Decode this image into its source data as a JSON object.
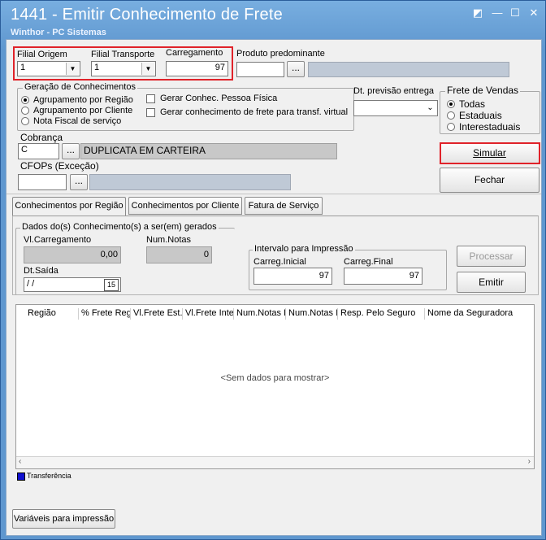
{
  "window": {
    "title": "1441 - Emitir Conhecimento de Frete",
    "subtitle": "Winthor - PC Sistemas",
    "controls": {
      "help": "◩",
      "minimize": "—",
      "maximize": "☐",
      "close": "✕"
    }
  },
  "filters": {
    "filial_origem": {
      "label": "Filial Origem",
      "value": "1"
    },
    "filial_transporte": {
      "label": "Filial Transporte",
      "value": "1"
    },
    "carregamento": {
      "label": "Carregamento",
      "value": "97"
    },
    "produto": {
      "label": "Produto predominante",
      "value": "",
      "button": "...",
      "description": ""
    }
  },
  "geracao": {
    "title": "Geração de Conhecimentos",
    "options": [
      "Agrupamento por Região",
      "Agrupamento por Cliente",
      "Nota Fiscal de serviço"
    ],
    "selected_index": 0,
    "checks": [
      "Gerar Conhec. Pessoa Física",
      "Gerar conhecimento de frete para transf. virtual"
    ]
  },
  "previsao": {
    "label": "Dt. previsão entrega",
    "value": ""
  },
  "frete_vendas": {
    "title": "Frete de Vendas",
    "options": [
      "Todas",
      "Estaduais",
      "Interestaduais"
    ],
    "selected_index": 0
  },
  "cobranca": {
    "label": "Cobrança",
    "code": "C",
    "button": "...",
    "description": "DUPLICATA EM CARTEIRA"
  },
  "cfops": {
    "label": "CFOPs  (Exceção)",
    "value": "",
    "button": "...",
    "description": ""
  },
  "actions": {
    "simular": "Simular",
    "fechar": "Fechar"
  },
  "tabs": [
    "Conhecimentos por Região",
    "Conhecimentos por Cliente",
    "Fatura de Serviço"
  ],
  "active_tab": 0,
  "dados": {
    "title": "Dados do(s) Conhecimento(s) a ser(em) gerados",
    "vl_carregamento_label": "Vl.Carregamento",
    "vl_carregamento": "0,00",
    "num_notas_label": "Num.Notas",
    "num_notas": "0",
    "dt_saida_label": "Dt.Saída",
    "dt_saida": " / /",
    "calendar": "15"
  },
  "intervalo": {
    "title": "Intervalo para Impressão",
    "inicial_label": "Carreg.Inicial",
    "inicial": "97",
    "final_label": "Carreg.Final",
    "final": "97"
  },
  "buttons2": {
    "processar": "Processar",
    "emitir": "Emitir"
  },
  "grid": {
    "columns": [
      "Região",
      "% Frete Reg",
      "Vl.Frete Est.",
      "Vl.Frete Inte",
      "Num.Notas E",
      "Num.Notas I",
      "Resp. Pelo Seguro",
      "Nome da Seguradora"
    ],
    "empty_text": "<Sem dados para mostrar>"
  },
  "legend": {
    "label": "Transferência",
    "color": "#1010d0"
  },
  "footer": {
    "variaveis": "Variáveis para impressão"
  },
  "highlight_color": "#e0232a"
}
